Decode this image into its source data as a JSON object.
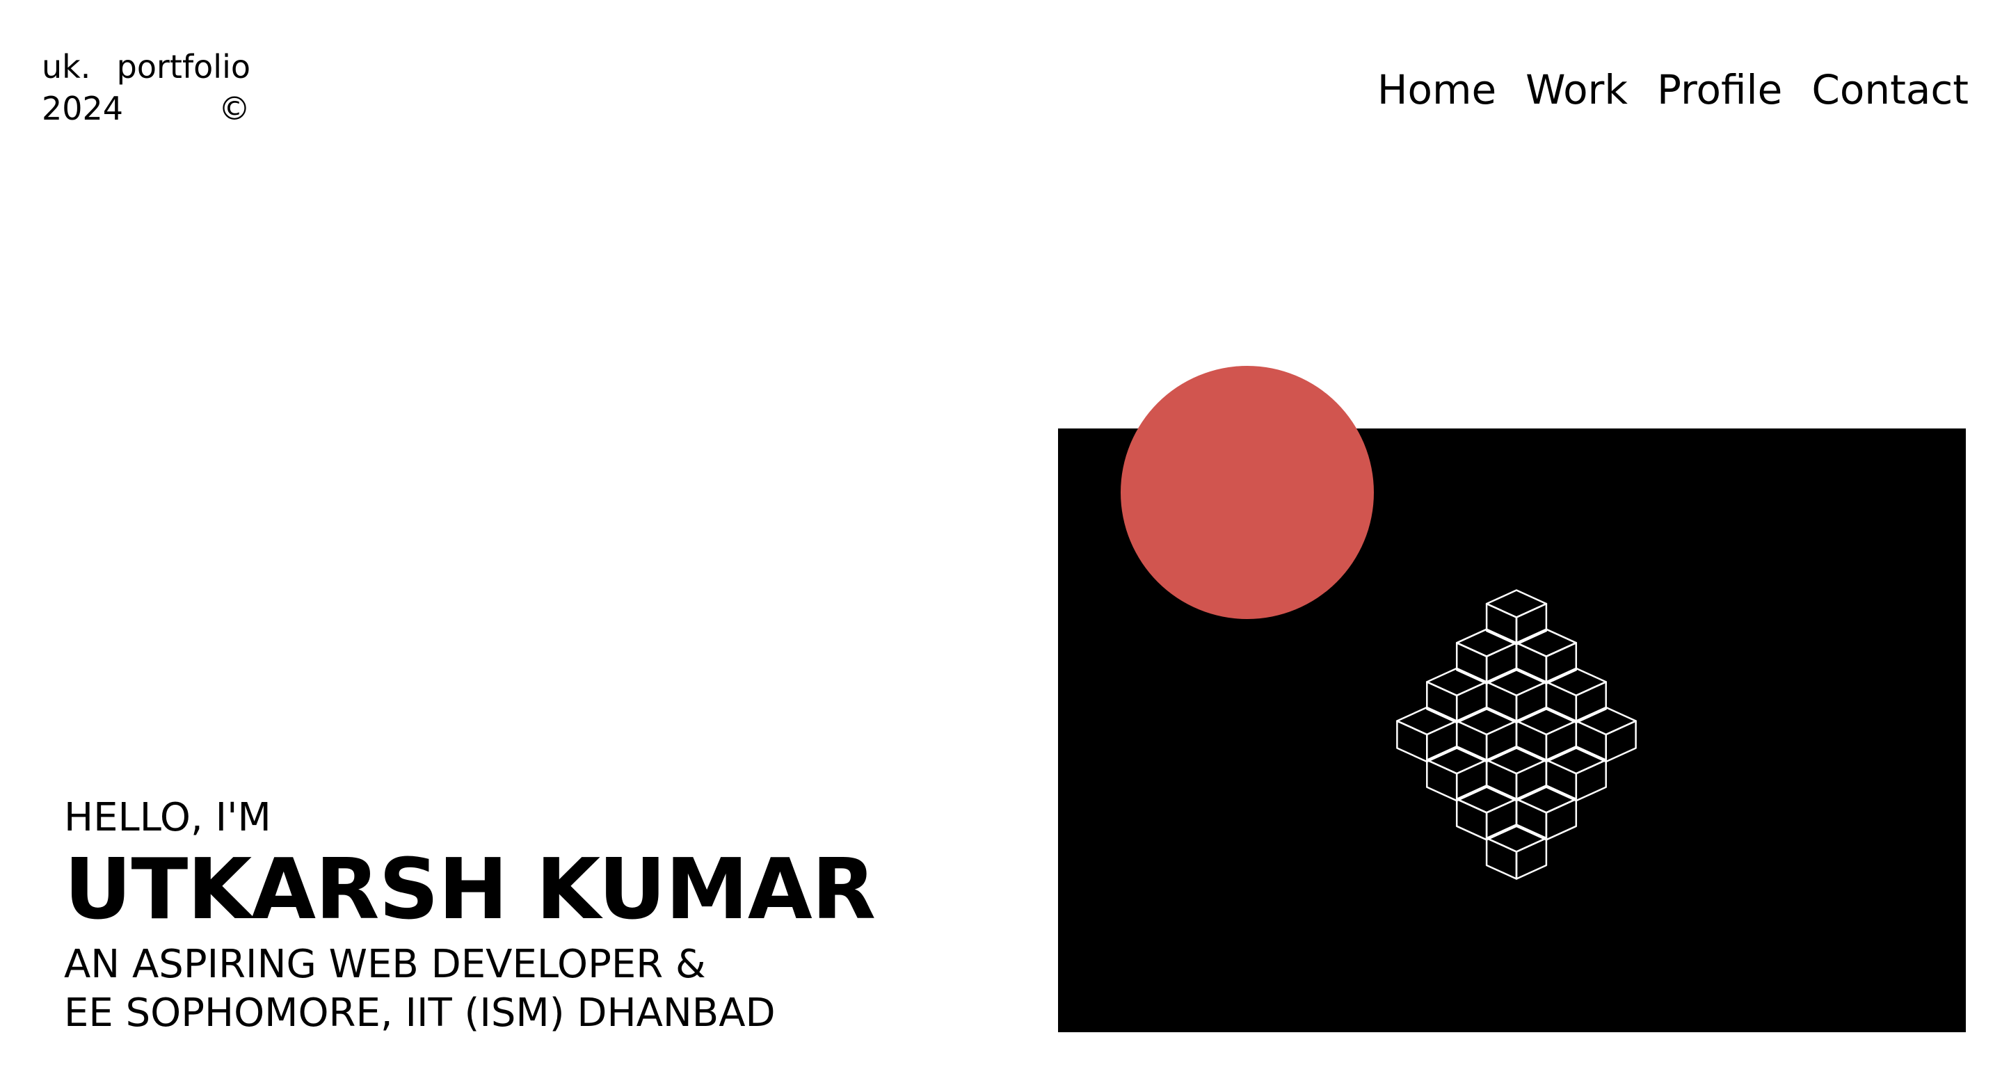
{
  "header": {
    "logo": {
      "line1_left": "uk.",
      "line1_right": "portfolio",
      "line2_left": "2024",
      "line2_right": "©"
    },
    "nav": [
      {
        "label": "Home"
      },
      {
        "label": "Work"
      },
      {
        "label": "Profile"
      },
      {
        "label": "Contact"
      }
    ]
  },
  "hero": {
    "greeting": "HELLO, I'M",
    "name": "UTKARSH KUMAR",
    "tagline_line1": "AN ASPIRING WEB DEVELOPER &",
    "tagline_line2": "EE SOPHOMORE, IIT (ISM) DHANBAD"
  },
  "artwork": {
    "panel_color": "#000000",
    "sun_color": "#d1554f",
    "line_color": "#ffffff",
    "illustration": "isometric-cube-grid"
  }
}
